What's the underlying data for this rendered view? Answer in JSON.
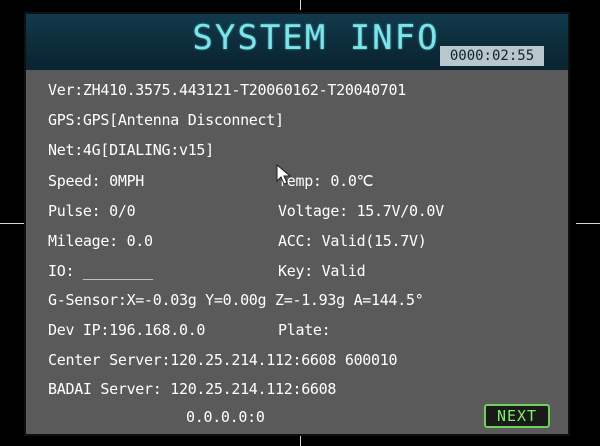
{
  "header": {
    "title": "SYSTEM INFO",
    "clock": "0000:02:55"
  },
  "info": {
    "version": "Ver:ZH410.3575.443121-T20060162-T20040701",
    "gps": "GPS:GPS[Antenna Disconnect]",
    "net": "Net:4G[DIALING:v15]",
    "speed": "Speed: 0MPH",
    "temp": "Temp: 0.0℃",
    "pulse": "Pulse: 0/0",
    "voltage": "Voltage: 15.7V/0.0V",
    "mileage": "Mileage: 0.0",
    "acc": "ACC: Valid(15.7V)",
    "io": "IO: ________",
    "key": "Key: Valid",
    "gsensor": "G-Sensor:X=-0.03g Y=0.00g Z=-1.93g A=144.5°",
    "dev_ip": "Dev IP:196.168.0.0",
    "plate": "Plate:",
    "center_server": "Center Server:120.25.214.112:6608 600010",
    "badai_server": "BADAI Server: 120.25.214.112:6608",
    "extra_server": "0.0.0.0:0"
  },
  "buttons": {
    "next": "NEXT"
  },
  "colors": {
    "title": "#7fe4ea",
    "titlebar": "#0d2c3a",
    "panel": "#5a5a5a",
    "text": "#ffffff",
    "next_border": "#6fcf5c"
  },
  "icons": {
    "cursor": "mouse-pointer-icon"
  }
}
